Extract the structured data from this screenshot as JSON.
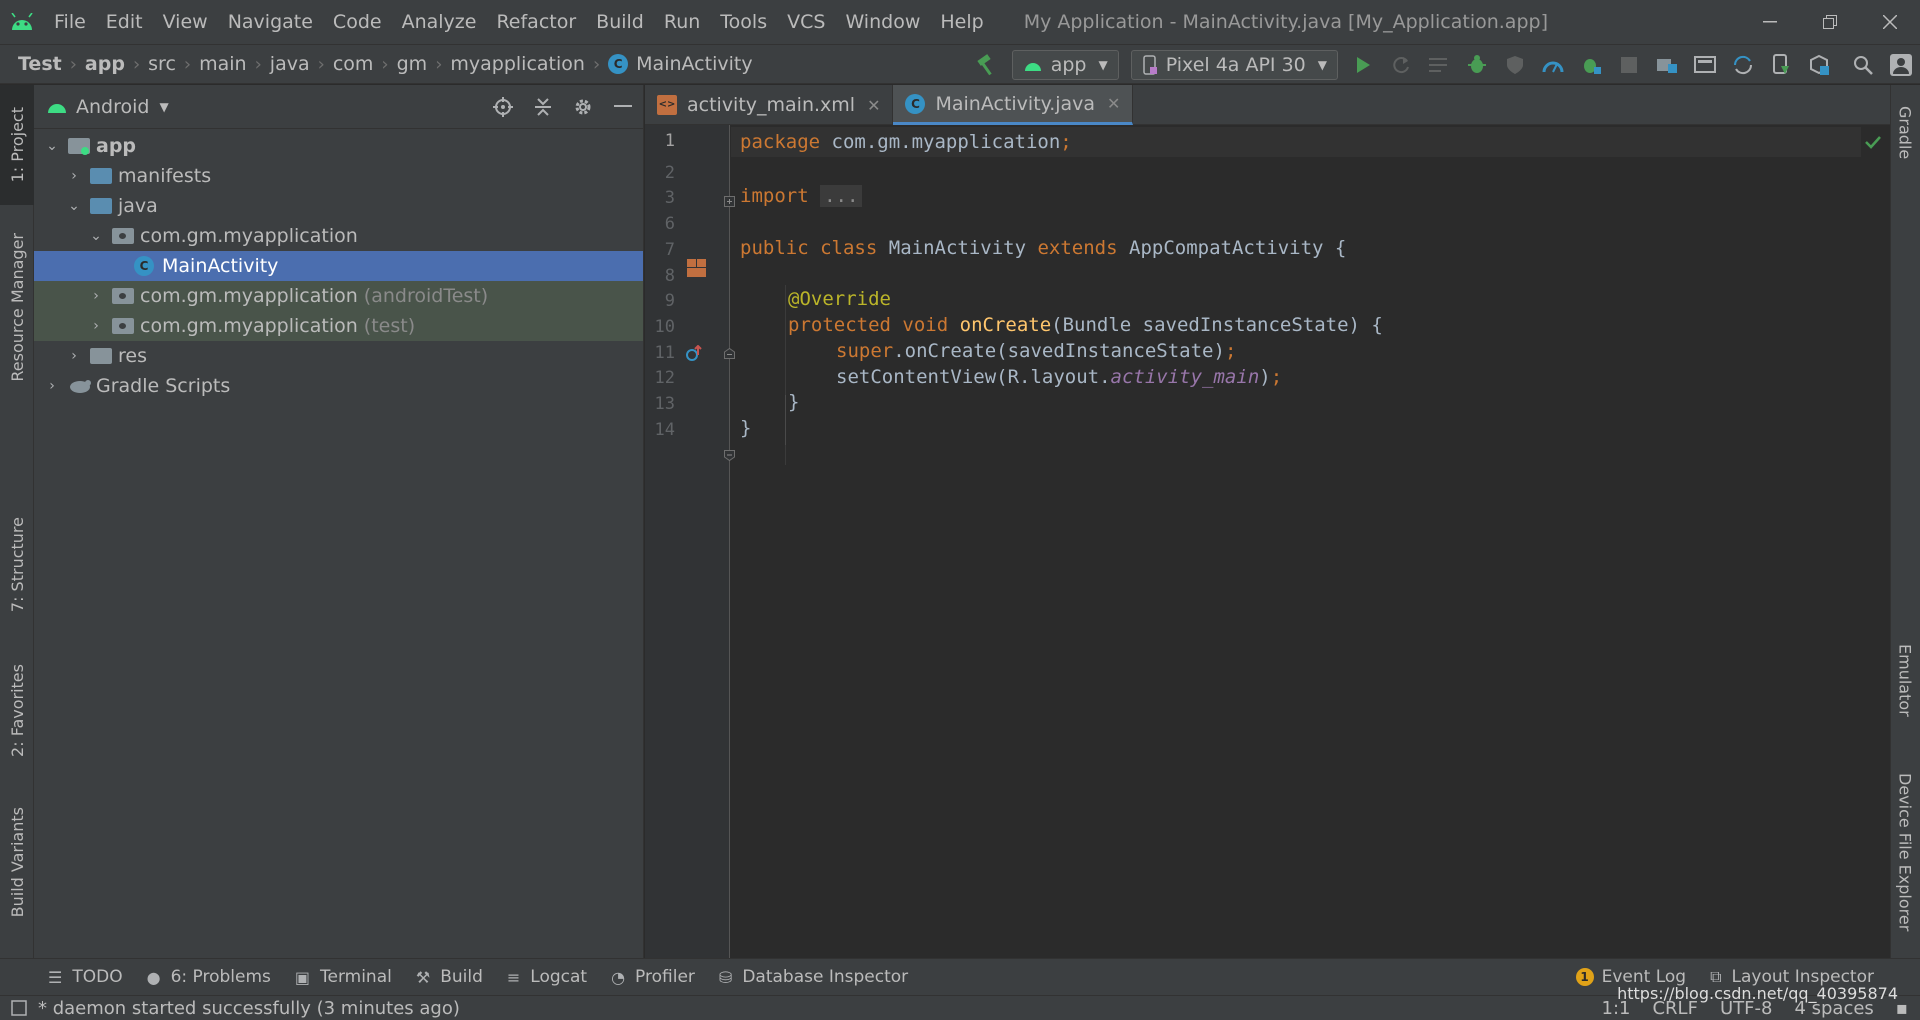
{
  "menubar": {
    "items": [
      "File",
      "Edit",
      "View",
      "Navigate",
      "Code",
      "Analyze",
      "Refactor",
      "Build",
      "Run",
      "Tools",
      "VCS",
      "Window",
      "Help"
    ],
    "window_title": "My Application - MainActivity.java [My_Application.app]"
  },
  "breadcrumb": [
    "Test",
    "app",
    "src",
    "main",
    "java",
    "com",
    "gm",
    "myapplication",
    "MainActivity"
  ],
  "toolbar": {
    "run_config": "app",
    "device": "Pixel 4a API 30"
  },
  "left_tabs": [
    "1: Project",
    "Resource Manager",
    "7: Structure",
    "2: Favorites",
    "Build Variants"
  ],
  "right_tabs": [
    "Gradle",
    "Emulator",
    "Device File Explorer"
  ],
  "project": {
    "view": "Android",
    "tree": [
      {
        "label": "app",
        "suffix": ""
      },
      {
        "label": "manifests",
        "suffix": ""
      },
      {
        "label": "java",
        "suffix": ""
      },
      {
        "label": "com.gm.myapplication",
        "suffix": ""
      },
      {
        "label": "MainActivity",
        "suffix": ""
      },
      {
        "label": "com.gm.myapplication",
        "suffix": "(androidTest)"
      },
      {
        "label": "com.gm.myapplication",
        "suffix": "(test)"
      },
      {
        "label": "res",
        "suffix": ""
      },
      {
        "label": "Gradle Scripts",
        "suffix": ""
      }
    ]
  },
  "editor": {
    "tabs": [
      {
        "label": "activity_main.xml"
      },
      {
        "label": "MainActivity.java"
      }
    ],
    "line_numbers": [
      "1",
      "2",
      "3",
      "6",
      "7",
      "8",
      "9",
      "10",
      "11",
      "12",
      "13",
      "14"
    ],
    "code": {
      "l1_kw": "package",
      "l1_rest": " com.gm.myapplication",
      "l1_semi": ";",
      "l3_kw": "import",
      "l3_fold": "...",
      "l7_kw1": "public",
      "l7_kw2": "class",
      "l7_name": "MainActivity",
      "l7_kw3": "extends",
      "l7_rest": "AppCompatActivity {",
      "l9_ann": "@Override",
      "l10_kw1": "protected",
      "l10_kw2": "void",
      "l10_fn": "onCreate",
      "l10_rest": "(Bundle savedInstanceState) {",
      "l11_kw": "super",
      "l11_rest": ".onCreate(savedInstanceState)",
      "l11_semi": ";",
      "l12_a": "setContentView(R.layout.",
      "l12_fld": "activity_main",
      "l12_b": ")",
      "l12_semi": ";",
      "l13": "}",
      "l14": "}"
    }
  },
  "bottom_tools": {
    "todo": "TODO",
    "problems": "6: Problems",
    "terminal": "Terminal",
    "build": "Build",
    "logcat": "Logcat",
    "profiler": "Profiler",
    "db_inspector": "Database Inspector",
    "event_log": "Event Log",
    "event_log_count": "1",
    "layout_inspector": "Layout Inspector"
  },
  "status": {
    "message": "* daemon started successfully (3 minutes ago)",
    "position": "1:1",
    "line_sep": "CRLF",
    "encoding": "UTF-8",
    "indent": "4 spaces",
    "watermark": "https://blog.csdn.net/qq_40395874"
  },
  "colors": {
    "accent": "#4a88c7",
    "selection": "#4b6eaf",
    "keyword": "#cc7832",
    "annotation": "#bbb529",
    "function": "#ffc66d",
    "field": "#9876aa",
    "run_green": "#499c54",
    "android_green": "#3ddc84"
  }
}
